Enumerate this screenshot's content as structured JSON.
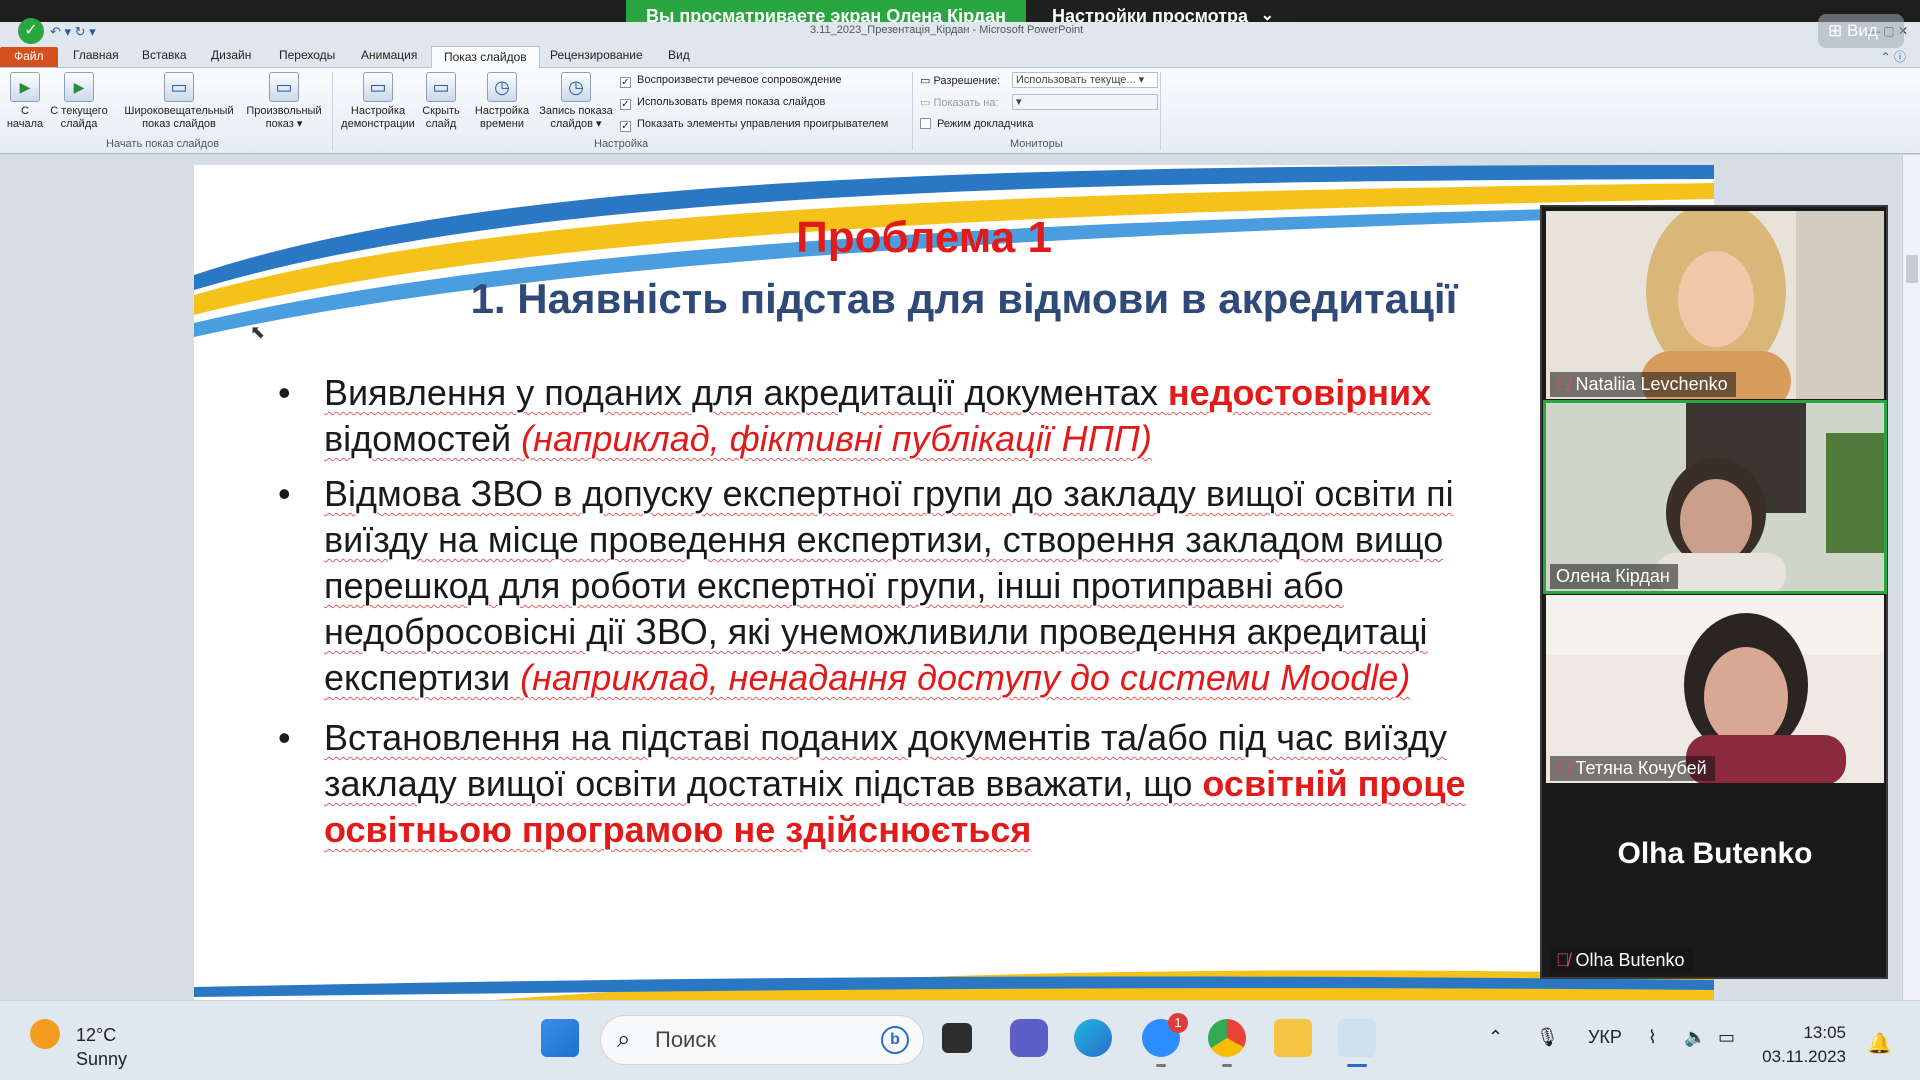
{
  "zoom": {
    "share_banner": "Вы просматриваете экран Олена Кірдан",
    "view_settings": "Настройки просмотра",
    "view_button": "Вид"
  },
  "ppt": {
    "window_title": "3.11_2023_Презентація_Кірдан - Microsoft PowerPoint",
    "tabs": [
      "Файл",
      "Главная",
      "Вставка",
      "Дизайн",
      "Переходы",
      "Анимация",
      "Показ слайдов",
      "Рецензирование",
      "Вид"
    ],
    "active_tab": "Показ слайдов",
    "ribbon": {
      "from_start": [
        "С",
        "начала"
      ],
      "from_current": [
        "С текущего",
        "слайда"
      ],
      "broadcast": [
        "Широковещательный",
        "показ слайдов"
      ],
      "custom_show": [
        "Произвольный",
        "показ ▾"
      ],
      "group_start": "Начать показ слайдов",
      "setup_show": [
        "Настройка",
        "демонстрации"
      ],
      "hide_slide": [
        "Скрыть",
        "слайд"
      ],
      "rehearse": [
        "Настройка",
        "времени"
      ],
      "record": [
        "Запись показа",
        "слайдов ▾"
      ],
      "check_narration": "Воспроизвести речевое сопровождение",
      "check_timings": "Использовать время показа слайдов",
      "check_controls": "Показать элементы управления проигрывателем",
      "group_setup": "Настройка",
      "resolution_label": "Разрешение:",
      "resolution_value": "Использовать текуще...",
      "show_on_label": "Показать на:",
      "presenter_view": "Режим докладчика",
      "group_monitors": "Мониторы"
    }
  },
  "slide": {
    "title": "Проблема 1",
    "subtitle": "1. Наявність підстав для відмови в акредитації",
    "bullet1_a": "Виявлення у поданих для акредитації документах ",
    "bullet1_red": "недостовірних",
    "bullet1_b": "відомостей ",
    "bullet1_ex": "(наприклад, фіктивні публікації НПП)",
    "bullet2_l1": "Відмова ЗВО в допуску експертної групи до закладу вищої освіти пі",
    "bullet2_l2": "виїзду на місце проведення експертизи, створення закладом вищо",
    "bullet2_l3": "перешкод для роботи експертної групи, інші протиправні або",
    "bullet2_l4": "недобросовісні дії ЗВО, які унеможливили проведення акредитаці",
    "bullet2_l5a": "експертизи ",
    "bullet2_ex": "(наприклад, ненадання доступу до системи Moodle)",
    "bullet3_l1": " Встановлення на підставі поданих документів та/або під час виїзду",
    "bullet3_l2a": "закладу вищої освіти достатніх підстав вважати, що ",
    "bullet3_l2red": "освітній проце",
    "bullet3_l3red": "освітньою програмою не здійснюється"
  },
  "participants": [
    {
      "name": "Nataliia Levchenko",
      "muted": true
    },
    {
      "name": "Олена Кірдан",
      "muted": false,
      "active": true
    },
    {
      "name": "Тетяна Кочубей",
      "muted": true
    },
    {
      "name": "Olha Butenko",
      "muted": true,
      "video": false
    }
  ],
  "taskbar": {
    "temp": "12°C",
    "weather": "Sunny",
    "search_placeholder": "Поиск",
    "zoom_badge": "1",
    "lang": "УКР",
    "time": "13:05",
    "date": "03.11.2023"
  }
}
